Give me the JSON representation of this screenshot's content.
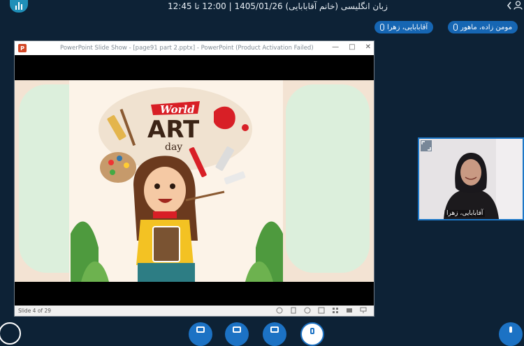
{
  "meeting": {
    "title": "زبان انگلیسی (خانم آقابابایی) 1405/01/26 | 12:00 تا 12:45"
  },
  "speakers": [
    {
      "name": "مومن زاده، ماهور"
    },
    {
      "name": "آقابابایی، زهرا"
    }
  ],
  "slideshow": {
    "window_title": "PowerPoint Slide Show - [page91 part 2.pptx] - PowerPoint (Product Activation Failed)",
    "app_icon": "P",
    "slide_status": "Slide 4 of 29",
    "slide": {
      "heading_word1": "World",
      "heading_word2": "ART",
      "heading_word3": "day"
    }
  },
  "webcam": {
    "label": "آقابابایی، زهرا"
  },
  "icons": [
    "stats-icon",
    "user-icon",
    "chevron-left-icon",
    "mic-icon",
    "expand-icon",
    "camera-icon",
    "share-icon",
    "presentation-icon"
  ],
  "colors": {
    "background": "#0d2236",
    "accent": "#1c72c4",
    "pill": "#1666b3"
  }
}
